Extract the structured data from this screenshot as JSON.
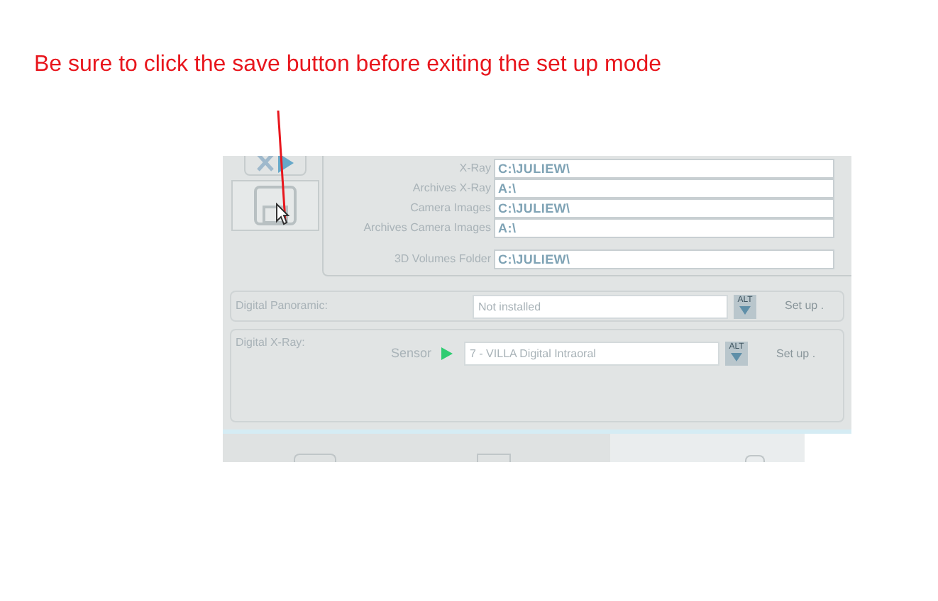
{
  "annotation": {
    "text": "Be sure to click the save button before exiting the set up mode"
  },
  "paths": [
    {
      "label": "X-Ray",
      "value": "C:\\JULIEW\\"
    },
    {
      "label": "Archives X-Ray",
      "value": "A:\\"
    },
    {
      "label": "Camera Images",
      "value": "C:\\JULIEW\\"
    },
    {
      "label": "Archives Camera Images",
      "value": "A:\\"
    }
  ],
  "volumes": {
    "label": "3D Volumes Folder",
    "value": "C:\\JULIEW\\"
  },
  "panoramic": {
    "label": "Digital Panoramic:",
    "value": "Not installed",
    "alt": "ALT",
    "setup": "Set up ."
  },
  "xray": {
    "label": "Digital X-Ray:",
    "sensor_label": "Sensor",
    "value": "7 - VILLA Digital Intraoral",
    "alt": "ALT",
    "setup": "Set up ."
  }
}
